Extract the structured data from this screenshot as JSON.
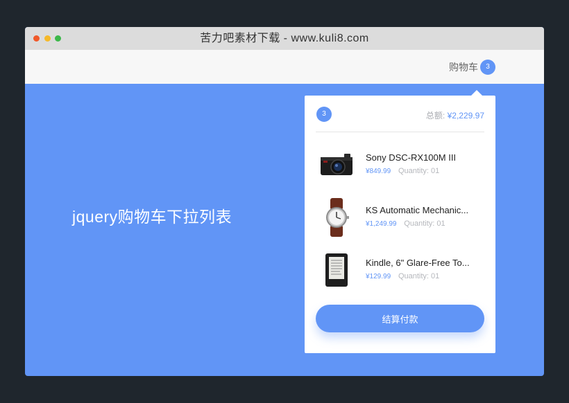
{
  "window": {
    "title": "苦力吧素材下载 - www.kuli8.com"
  },
  "navbar": {
    "cart_label": "购物车",
    "cart_count": "3"
  },
  "hero": {
    "text": "jquery购物车下拉列表"
  },
  "dropdown": {
    "count": "3",
    "total_label": "总额:",
    "total_amount": "¥2,229.97",
    "items": [
      {
        "name": "Sony DSC-RX100M III",
        "price": "¥849.99",
        "quantity": "Quantity: 01",
        "icon": "camera-icon"
      },
      {
        "name": "KS Automatic Mechanic...",
        "price": "¥1,249.99",
        "quantity": "Quantity: 01",
        "icon": "watch-icon"
      },
      {
        "name": "Kindle, 6\" Glare-Free To...",
        "price": "¥129.99",
        "quantity": "Quantity: 01",
        "icon": "ereader-icon"
      }
    ],
    "checkout_label": "结算付款"
  },
  "colors": {
    "accent": "#6195f6",
    "background": "#1f262d",
    "titlebar": "#dcdcdc",
    "navbar": "#f7f7f7"
  }
}
